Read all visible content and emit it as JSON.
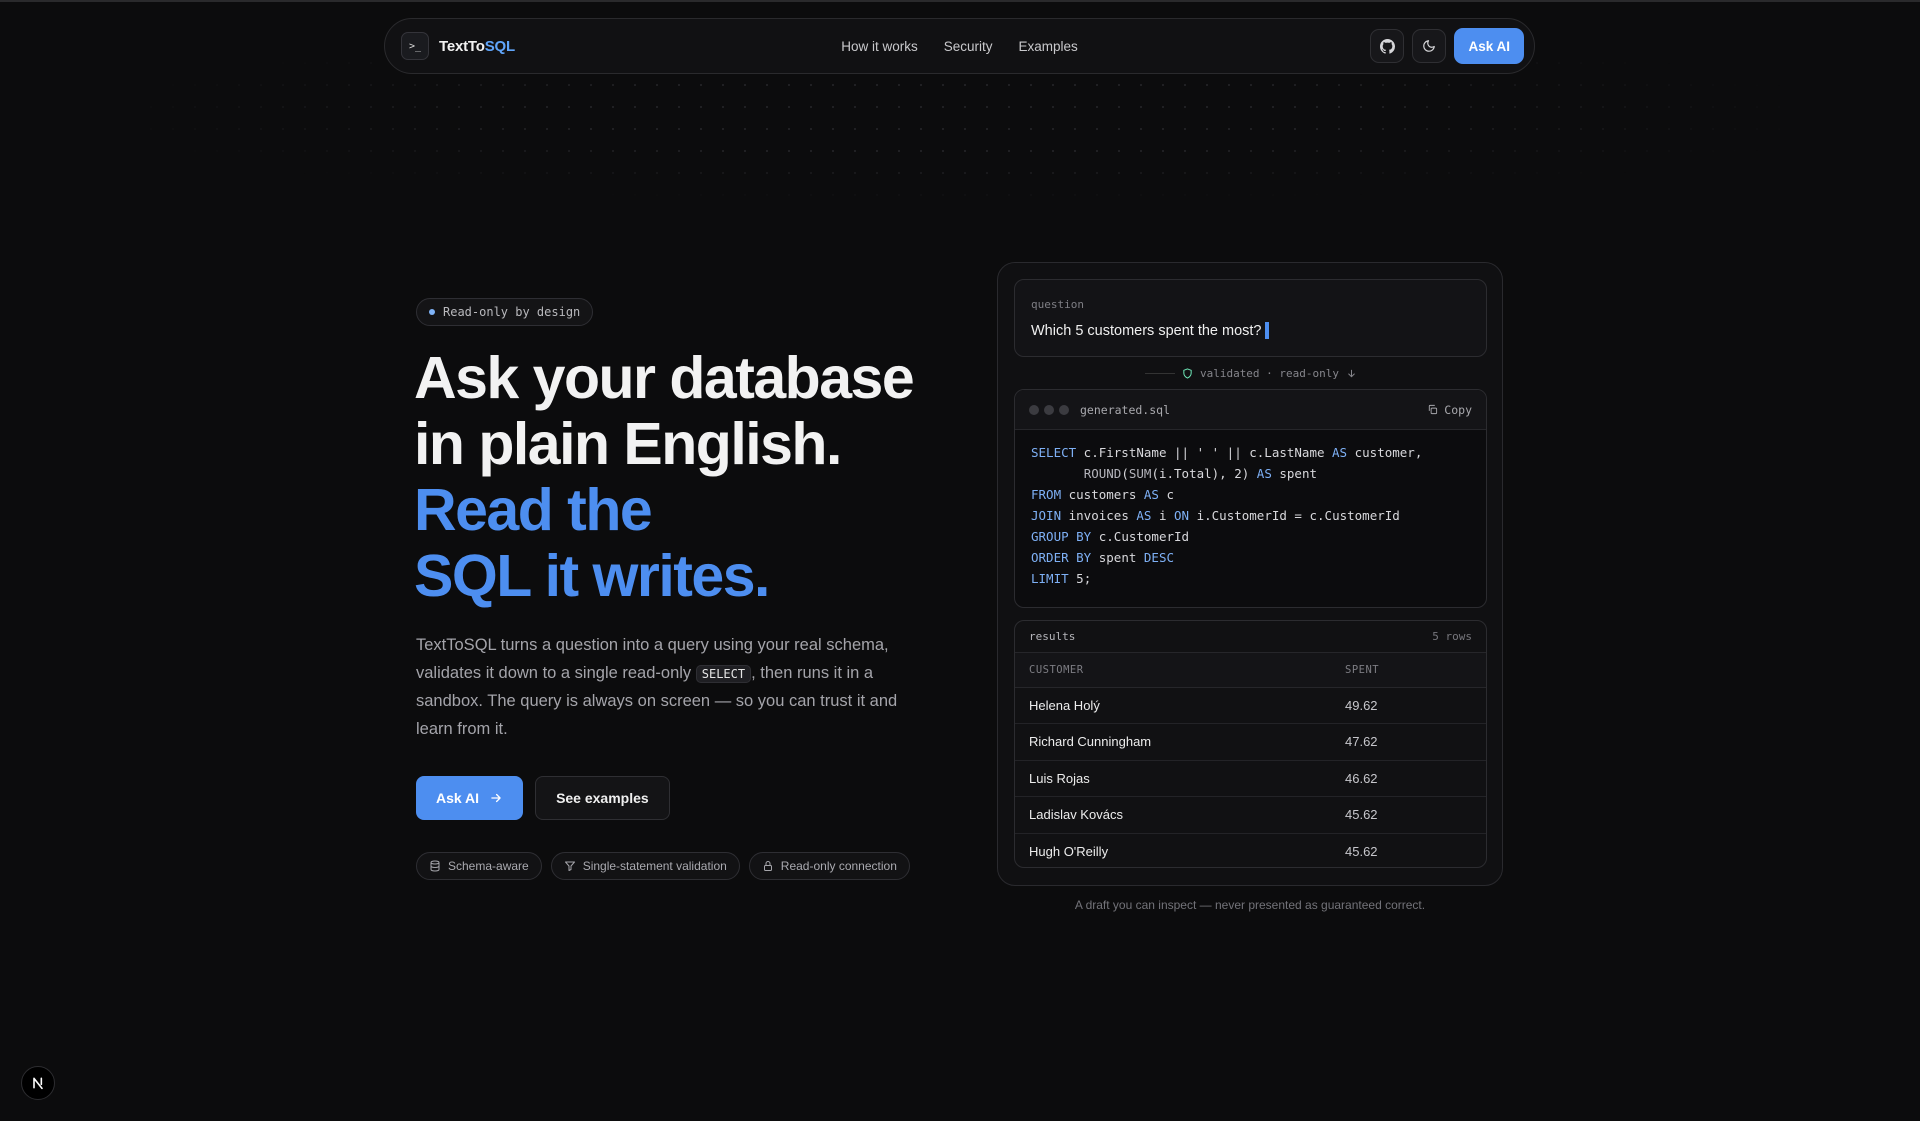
{
  "nav": {
    "brand_prefix": "TextTo",
    "brand_suffix": "SQL",
    "logo_icon": "terminal-prompt-icon",
    "links": [
      {
        "label": "How it works"
      },
      {
        "label": "Security"
      },
      {
        "label": "Examples"
      }
    ],
    "github_icon": "github-icon",
    "theme_icon": "moon-icon",
    "ask_label": "Ask AI"
  },
  "hero": {
    "badge": "Read-only by design",
    "headline_line1": "Ask your database",
    "headline_line2": "in plain English.",
    "headline_line3": "Read the",
    "headline_line4": "SQL it writes.",
    "para_part1": "TextToSQL turns a question into a query using your real schema, validates it down to a single read-only ",
    "para_code": "SELECT",
    "para_part2": ", then runs it in a sandbox. The query is always on screen — so you can trust it and learn from it.",
    "primary_cta": "Ask AI",
    "secondary_cta": "See examples",
    "chips": [
      {
        "label": "Schema-aware",
        "icon": "database-icon"
      },
      {
        "label": "Single-statement validation",
        "icon": "filter-icon"
      },
      {
        "label": "Read-only connection",
        "icon": "lock-icon"
      }
    ]
  },
  "demo": {
    "question_label": "question",
    "question_text": "Which 5 customers spent the most?",
    "validated_text": "validated · read-only",
    "file_name": "generated.sql",
    "copy_label": "Copy",
    "results_label": "results",
    "rows_label": "5 rows",
    "columns": [
      "CUSTOMER",
      "SPENT"
    ],
    "rows": [
      {
        "customer": "Helena Holý",
        "spent": "49.62"
      },
      {
        "customer": "Richard Cunningham",
        "spent": "47.62"
      },
      {
        "customer": "Luis Rojas",
        "spent": "46.62"
      },
      {
        "customer": "Ladislav Kovács",
        "spent": "45.62"
      },
      {
        "customer": "Hugh O'Reilly",
        "spent": "45.62"
      }
    ],
    "footnote": "A draft you can inspect — never presented as guaranteed correct."
  },
  "colors": {
    "accent": "#4d8ef0",
    "background": "#0c0c0d"
  }
}
